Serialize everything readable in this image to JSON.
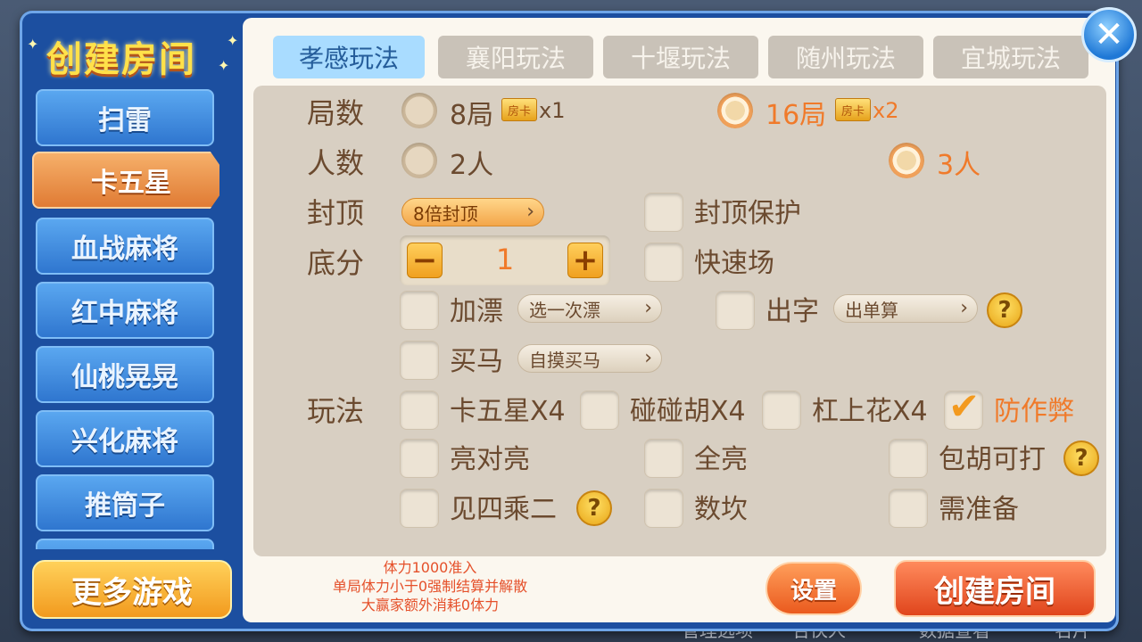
{
  "title": "创建房间",
  "sidebar": {
    "items": [
      {
        "label": "扫雷",
        "active": false
      },
      {
        "label": "卡五星",
        "active": true
      },
      {
        "label": "血战麻将",
        "active": false
      },
      {
        "label": "红中麻将",
        "active": false
      },
      {
        "label": "仙桃晃晃",
        "active": false
      },
      {
        "label": "兴化麻将",
        "active": false
      },
      {
        "label": "推筒子",
        "active": false
      }
    ],
    "more_label": "更多游戏"
  },
  "tabs": [
    {
      "label": "孝感玩法",
      "active": true
    },
    {
      "label": "襄阳玩法",
      "active": false
    },
    {
      "label": "十堰玩法",
      "active": false
    },
    {
      "label": "随州玩法",
      "active": false
    },
    {
      "label": "宜城玩法",
      "active": false
    }
  ],
  "settings": {
    "rounds": {
      "label": "局数",
      "card_icon": "房卡",
      "options": [
        {
          "label": "8局",
          "mult": "x1",
          "selected": false
        },
        {
          "label": "16局",
          "mult": "x2",
          "selected": true
        }
      ]
    },
    "players": {
      "label": "人数",
      "options": [
        {
          "label": "2人",
          "selected": false
        },
        {
          "label": "3人",
          "selected": true
        }
      ]
    },
    "cap": {
      "label": "封顶",
      "dropdown": "8倍封顶",
      "protect_label": "封顶保护",
      "protect_checked": false
    },
    "base": {
      "label": "底分",
      "value": "1",
      "minus": "−",
      "plus": "+",
      "fast_label": "快速场",
      "fast_checked": false
    },
    "piao": {
      "label": "加漂",
      "checked": false,
      "dropdown": "选一次漂"
    },
    "chuzi": {
      "label": "出字",
      "checked": false,
      "dropdown": "出单算"
    },
    "maima": {
      "label": "买马",
      "checked": false,
      "dropdown": "自摸买马"
    },
    "rules": {
      "label": "玩法",
      "items": [
        {
          "label": "卡五星X4",
          "checked": false
        },
        {
          "label": "碰碰胡X4",
          "checked": false
        },
        {
          "label": "杠上花X4",
          "checked": false
        },
        {
          "label": "防作弊",
          "checked": true
        },
        {
          "label": "亮对亮",
          "checked": false
        },
        {
          "label": "全亮",
          "checked": false
        },
        {
          "label": "包胡可打",
          "checked": false
        },
        {
          "label": "见四乘二",
          "checked": false
        },
        {
          "label": "数坎",
          "checked": false
        },
        {
          "label": "需准备",
          "checked": false
        }
      ]
    },
    "help_glyph": "?",
    "chevron_glyph": "›",
    "check_glyph": "✔"
  },
  "notice": {
    "line1": "体力1000准入",
    "line2": "单局体力小于0强制结算并解散",
    "line3": "大赢家额外消耗0体力"
  },
  "buttons": {
    "settings": "设置",
    "create": "创建房间",
    "close_glyph": "✕"
  },
  "background": {
    "bottom_labels": [
      "管理选项",
      "合伙人",
      "数据查看",
      "名片"
    ]
  },
  "colors": {
    "accent_orange": "#f07a2a",
    "brown_text": "#6b4a2f",
    "dialog_blue": "#1c4fa0"
  }
}
